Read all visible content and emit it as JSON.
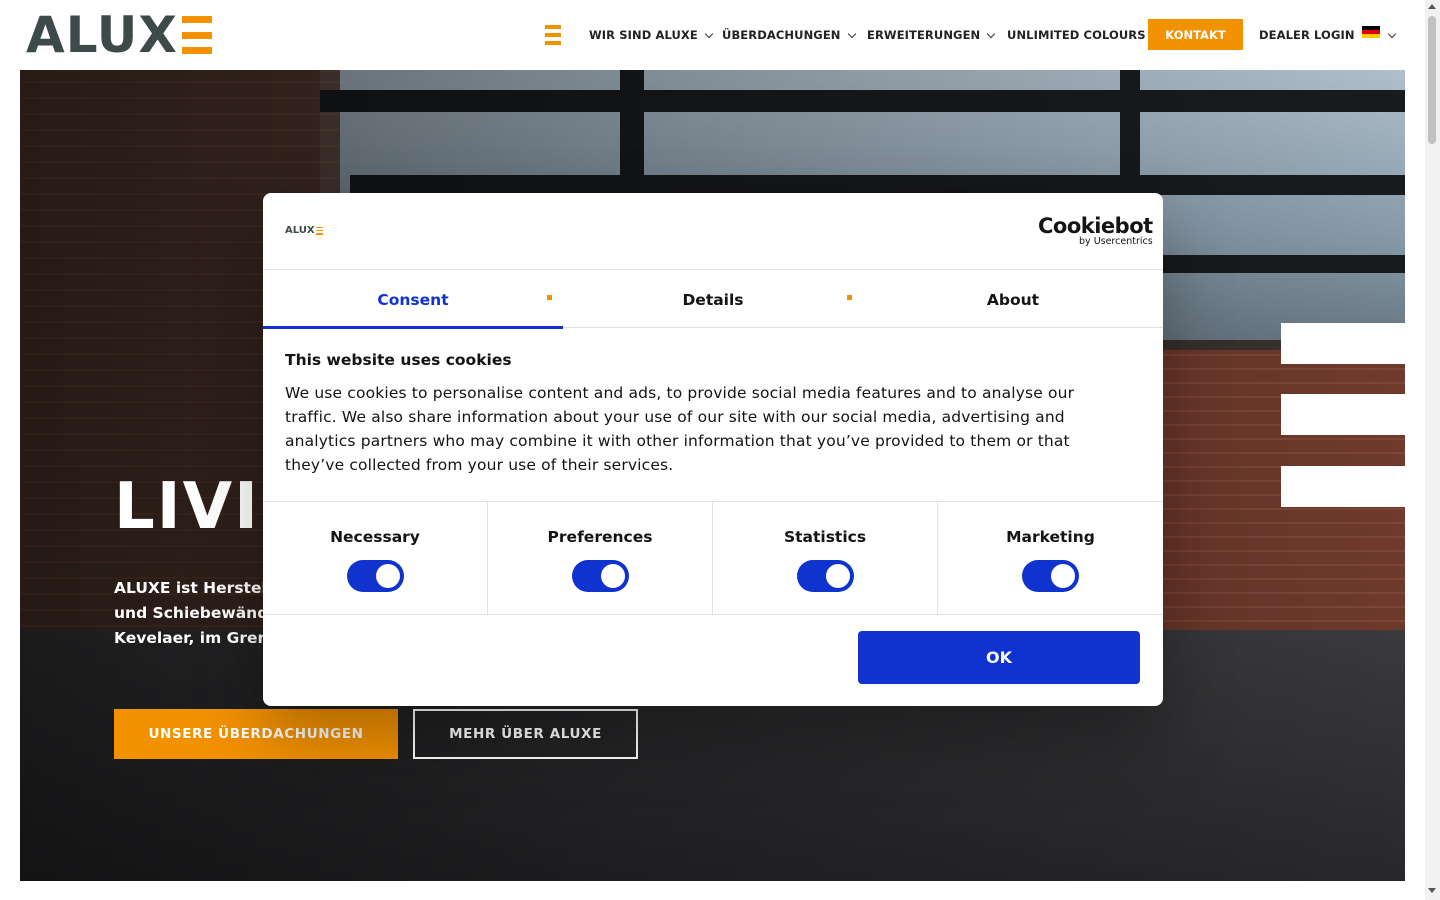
{
  "header": {
    "logo_text": "ALUX",
    "nav": [
      {
        "label": "WIR SIND ALUXE",
        "has_dropdown": true
      },
      {
        "label": "ÜBERDACHUNGEN",
        "has_dropdown": true
      },
      {
        "label": "ERWEITERUNGEN",
        "has_dropdown": true
      },
      {
        "label": "UNLIMITED COLOURS",
        "has_dropdown": false
      }
    ],
    "kontakt_label": "KONTAKT",
    "dealer_login_label": "DEALER LOGIN",
    "language_icon": "flag-germany-icon",
    "accent_color": "#f39200"
  },
  "hero": {
    "title": "LIVI",
    "text_lines": [
      "ALUXE ist Herstell",
      "und Schiebewänd",
      "Kevelaer, im Gren"
    ],
    "primary_button": "UNSERE ÜBERDACHUNGEN",
    "secondary_button": "MEHR ÜBER ALUXE"
  },
  "cookie_dialog": {
    "logo_text": "ALUX",
    "brand_name": "Cookiebot",
    "brand_by": "by Usercentrics",
    "tabs": [
      {
        "label": "Consent",
        "active": true
      },
      {
        "label": "Details",
        "active": false
      },
      {
        "label": "About",
        "active": false
      }
    ],
    "title": "This website uses cookies",
    "text_lines": [
      "We use cookies to personalise content and ads, to provide social media features and to analyse our",
      "traffic. We also share information about your use of our site with our social media, advertising and",
      "analytics partners who may combine it with other information that you’ve provided to them or that",
      "they’ve collected from your use of their services."
    ],
    "categories": [
      {
        "label": "Necessary",
        "enabled": true
      },
      {
        "label": "Preferences",
        "enabled": true
      },
      {
        "label": "Statistics",
        "enabled": true
      },
      {
        "label": "Marketing",
        "enabled": true
      }
    ],
    "ok_label": "OK",
    "accent_color": "#1032cf"
  }
}
